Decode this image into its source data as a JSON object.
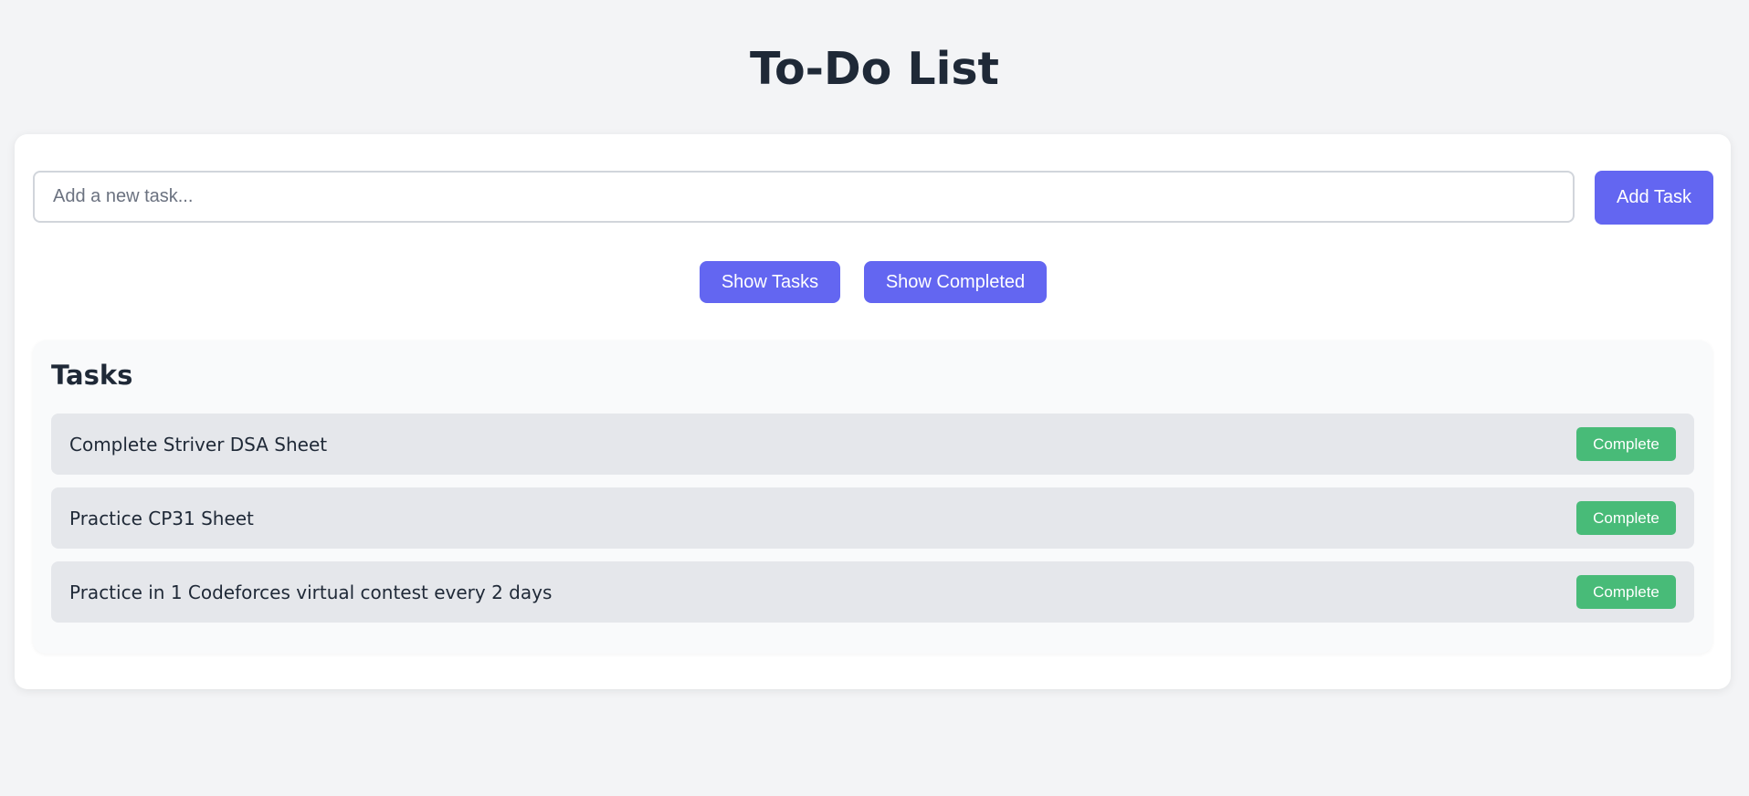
{
  "header": {
    "title": "To-Do List"
  },
  "new_task": {
    "placeholder": "Add a new task...",
    "value": "",
    "add_label": "Add Task"
  },
  "filters": {
    "show_tasks_label": "Show Tasks",
    "show_completed_label": "Show Completed"
  },
  "tasks": {
    "heading": "Tasks",
    "items": [
      {
        "text": "Complete Striver DSA Sheet",
        "action_label": "Complete"
      },
      {
        "text": "Practice CP31 Sheet",
        "action_label": "Complete"
      },
      {
        "text": "Practice in 1 Codeforces virtual contest every 2 days",
        "action_label": "Complete"
      }
    ]
  },
  "colors": {
    "background": "#f3f4f6",
    "primary": "#6366f1",
    "complete": "#48bb78",
    "task_row": "#e5e7eb",
    "text": "#1f2937"
  }
}
